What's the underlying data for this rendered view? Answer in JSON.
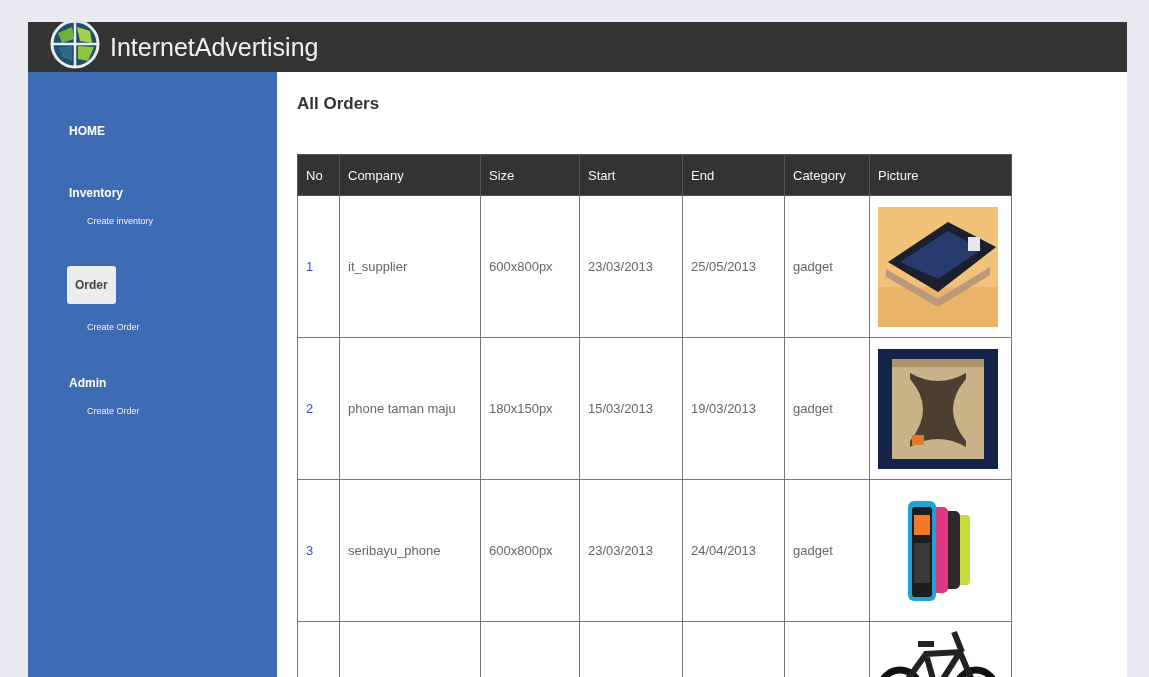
{
  "header": {
    "title": "InternetAdvertising"
  },
  "sidebar": {
    "sections": [
      {
        "label": "HOME",
        "selected": false
      },
      {
        "label": "Inventory",
        "selected": false,
        "children": [
          {
            "label": "Create inventory"
          }
        ]
      },
      {
        "label": "Order",
        "selected": true,
        "children": [
          {
            "label": "Create Order"
          }
        ]
      },
      {
        "label": "Admin",
        "selected": false,
        "children": [
          {
            "label": "Create Order"
          }
        ]
      }
    ]
  },
  "page": {
    "heading": "All Orders"
  },
  "table": {
    "columns": [
      "No",
      "Company",
      "Size",
      "Start",
      "End",
      "Category",
      "Picture"
    ],
    "rows": [
      {
        "no": "1",
        "company": "it_supplier",
        "size": "600x800px",
        "start": "23/03/2013",
        "end": "25/05/2013",
        "category": "gadget",
        "picture": {
          "kind": "picture"
        }
      },
      {
        "no": "2",
        "company": "phone taman maju",
        "size": "180x150px",
        "start": "15/03/2013",
        "end": "19/03/2013",
        "category": "gadget",
        "picture": {
          "kind": "picture"
        }
      },
      {
        "no": "3",
        "company": "seribayu_phone",
        "size": "600x800px",
        "start": "23/03/2013",
        "end": "24/04/2013",
        "category": "gadget",
        "picture": {
          "kind": "picture"
        }
      },
      {
        "picture": {
          "kind": "picture"
        }
      }
    ]
  }
}
